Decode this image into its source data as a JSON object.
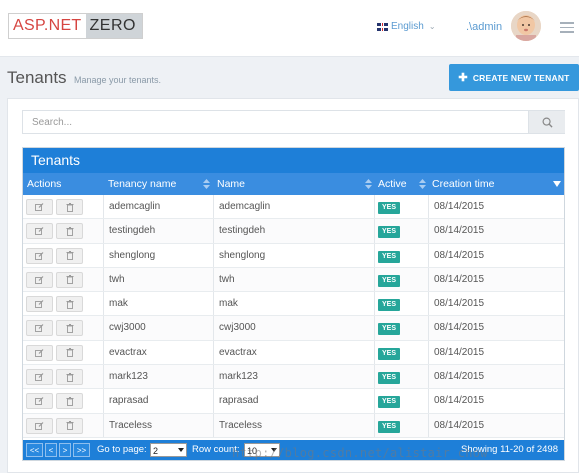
{
  "header": {
    "logo_part1": "ASP.NET",
    "logo_part2": "ZERO",
    "language": "English",
    "user": ".\\admin"
  },
  "page": {
    "title": "Tenants",
    "subtitle": "Manage your tenants.",
    "create_button": "CREATE NEW TENANT"
  },
  "search": {
    "placeholder": "Search..."
  },
  "grid": {
    "title": "Tenants",
    "columns": [
      "Actions",
      "Tenancy name",
      "Name",
      "Active",
      "Creation time"
    ],
    "rows": [
      {
        "tenancy": "ademcaglin",
        "name": "ademcaglin",
        "active": "YES",
        "created": "08/14/2015"
      },
      {
        "tenancy": "testingdeh",
        "name": "testingdeh",
        "active": "YES",
        "created": "08/14/2015"
      },
      {
        "tenancy": "shenglong",
        "name": "shenglong",
        "active": "YES",
        "created": "08/14/2015"
      },
      {
        "tenancy": "twh",
        "name": "twh",
        "active": "YES",
        "created": "08/14/2015"
      },
      {
        "tenancy": "mak",
        "name": "mak",
        "active": "YES",
        "created": "08/14/2015"
      },
      {
        "tenancy": "cwj3000",
        "name": "cwj3000",
        "active": "YES",
        "created": "08/14/2015"
      },
      {
        "tenancy": "evactrax",
        "name": "evactrax",
        "active": "YES",
        "created": "08/14/2015"
      },
      {
        "tenancy": "mark123",
        "name": "mark123",
        "active": "YES",
        "created": "08/14/2015"
      },
      {
        "tenancy": "raprasad",
        "name": "raprasad",
        "active": "YES",
        "created": "08/14/2015"
      },
      {
        "tenancy": "Traceless",
        "name": "Traceless",
        "active": "YES",
        "created": "08/14/2015"
      }
    ]
  },
  "pager": {
    "first": "<<",
    "prev": "<",
    "next": ">",
    "last": ">>",
    "goto_label": "Go to page:",
    "page_value": "2",
    "rowcount_label": "Row count:",
    "rowcount_value": "10",
    "status": "Showing 11-20 of 2498"
  },
  "watermark": "http://blog.csdn.net/alistair_chow",
  "colors": {
    "brand_blue": "#3598dc",
    "grid_title": "#1e7fd8",
    "grid_header": "#3a8de0",
    "active_badge": "#26a69a",
    "logo_red": "#d64541"
  }
}
